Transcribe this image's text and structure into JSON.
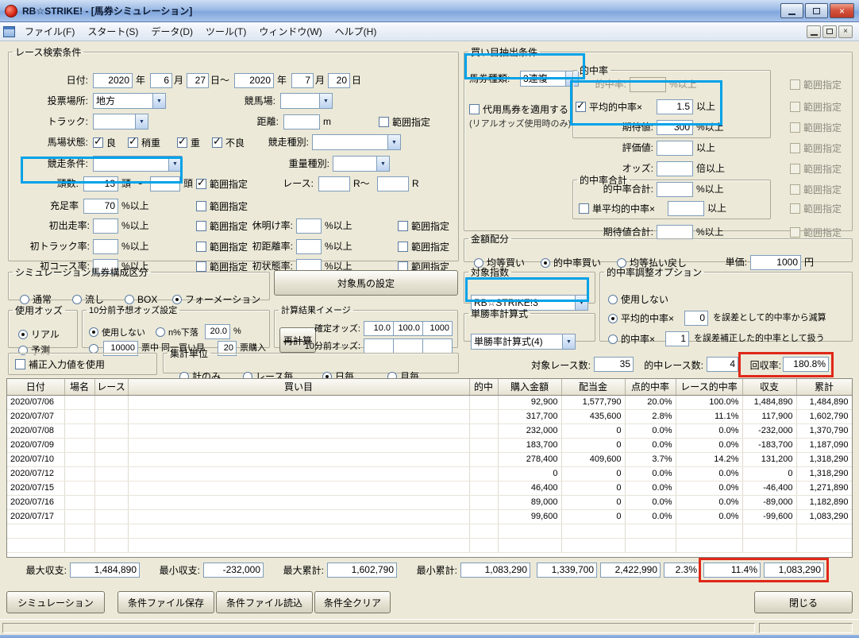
{
  "accent": {
    "annotation_blue": "#00a2e8",
    "annotation_red": "#e02818"
  },
  "win": {
    "title": "RB☆STRIKE! - [馬券シミュレーション]",
    "menu": [
      "ファイル(F)",
      "スタート(S)",
      "データ(D)",
      "ツール(T)",
      "ウィンドウ(W)",
      "ヘルプ(H)"
    ]
  },
  "search": {
    "title": "レース検索条件",
    "date": {
      "label": "日付:",
      "y1": "2020",
      "u1": "年",
      "m1": "6",
      "u2": "月",
      "d1": "27",
      "u3": "日～",
      "y2": "2020",
      "u4": "年",
      "m2": "7",
      "u5": "月",
      "d2": "20",
      "u6": "日"
    },
    "place": {
      "label": "投票場所:",
      "value": "地方"
    },
    "course": {
      "label": "競馬場:",
      "value": ""
    },
    "track": {
      "label": "トラック:",
      "value": ""
    },
    "dist": {
      "label": "距離:",
      "value": "",
      "unit": "m"
    },
    "range": "範囲指定",
    "baba": {
      "label": "馬場状態:",
      "o1": "良",
      "o2": "稍重",
      "o3": "重",
      "o4": "不良"
    },
    "shubetsu": {
      "label": "競走種別:",
      "value": ""
    },
    "joken": {
      "label": "競走条件:",
      "value": ""
    },
    "juryo": {
      "label": "重量種別:",
      "value": ""
    },
    "tosu": {
      "label": "頭数:",
      "v1": "13",
      "u1": "頭 ～",
      "v2": "",
      "u2": "頭"
    },
    "race_no": {
      "label": "レース:",
      "v1": "",
      "u1": "R～",
      "v2": "",
      "u2": "R"
    },
    "jusoku": {
      "label": "充足率",
      "value": "70",
      "unit": "%以上"
    },
    "r1": {
      "label": "初出走率:",
      "value": "",
      "unit": "%以上"
    },
    "r2": {
      "label": "休明け率:",
      "value": "",
      "unit": "%以上"
    },
    "r3": {
      "label": "初トラック率:",
      "value": "",
      "unit": "%以上"
    },
    "r4": {
      "label": "初距離率:",
      "value": "",
      "unit": "%以上"
    },
    "r5": {
      "label": "初コース率:",
      "value": "",
      "unit": "%以上"
    },
    "r6": {
      "label": "初状態率:",
      "value": "",
      "unit": "%以上"
    }
  },
  "extract": {
    "title": "買い目抽出条件",
    "type": {
      "label": "馬券種類:",
      "value": "3連複"
    },
    "daiyo": {
      "label": "代用馬券を適用する",
      "note": "(リアルオッズ使用時のみ)"
    },
    "hit_group": "的中率",
    "hit": {
      "label": "的中率:",
      "value": "",
      "unit": "%以上"
    },
    "avg": {
      "label": "平均的中率×",
      "value": "1.5",
      "unit": "以上"
    },
    "kitai": {
      "label": "期待値:",
      "value": "300",
      "unit": "%以上"
    },
    "hyoka": {
      "label": "評価値:",
      "value": "",
      "unit": "以上"
    },
    "odds": {
      "label": "オッズ:",
      "value": "",
      "unit": "倍以上"
    },
    "sum_group": "的中率合計",
    "hitsum": {
      "label": "的中率合計:",
      "value": "",
      "unit": "%以上"
    },
    "tanavg": {
      "label": "単平均的中率×",
      "value": "",
      "unit": "以上"
    },
    "kitaisum": {
      "label": "期待値合計:",
      "value": "",
      "unit": "%以上"
    },
    "range": "範囲指定"
  },
  "money": {
    "title": "金額配分",
    "o1": "均等買い",
    "o2": "的中率買い",
    "o3": "均等払い戻し",
    "unit_label": "単価:",
    "unit_value": "1000",
    "unit_suffix": "円"
  },
  "index": {
    "title": "対象指数",
    "value": "RB☆STRIKE!3"
  },
  "tansho": {
    "title": "単勝率計算式",
    "value": "単勝率計算式(4)"
  },
  "adjust": {
    "title": "的中率調整オプション",
    "o1": "使用しない",
    "o2a": "平均的中率×",
    "o2v": "0",
    "o2b": "を誤差として的中率から減算",
    "o3a": "的中率×",
    "o3v": "1",
    "o3b": "を誤差補正した的中率として扱う"
  },
  "kubun": {
    "title": "シミュレーション馬券構成区分",
    "o1": "通常",
    "o2": "流し",
    "o3": "BOX",
    "o4": "フォーメーション"
  },
  "target_btn": "対象馬の設定",
  "oddsrc": {
    "title": "使用オッズ",
    "o1": "リアル",
    "o2": "予測"
  },
  "pre10": {
    "title": "10分前予想オッズ設定",
    "o1": "使用しない",
    "o2a": "n%下落",
    "o2v": "20.0",
    "o2b": "%",
    "o3v1": "10000",
    "o3a": "票中 同一買い目",
    "o3v2": "20",
    "o3b": "票購入"
  },
  "calc": {
    "title": "計算結果イメージ",
    "recalc": "再計算",
    "row1_label": "確定オッズ:",
    "r1v1": "10.0",
    "r1v2": "100.0",
    "r1v3": "1000",
    "row2_label": "10分前オッズ:",
    "r2v1": "",
    "r2v2": "",
    "r2v3": ""
  },
  "hosei_label": "補正入力値を使用",
  "agg": {
    "title": "集計単位",
    "o1": "計のみ",
    "o2": "レース毎",
    "o3": "日毎",
    "o4": "月毎"
  },
  "stats": {
    "races_label": "対象レース数:",
    "races": "35",
    "hits_label": "的中レース数:",
    "hits": "4",
    "payout_label": "回収率:",
    "payout": "180.8%"
  },
  "table": {
    "headers": [
      "日付",
      "場名",
      "レース",
      "買い目",
      "的中",
      "購入金額",
      "配当金",
      "点的中率",
      "レース的中率",
      "収支",
      "累計"
    ],
    "rows": [
      {
        "date": "2020/07/06",
        "place": "",
        "race": "",
        "buy": "",
        "hit": "",
        "amount": "92,900",
        "payout": "1,577,790",
        "pt_rate": "20.0%",
        "race_rate": "100.0%",
        "balance": "1,484,890",
        "cum": "1,484,890"
      },
      {
        "date": "2020/07/07",
        "place": "",
        "race": "",
        "buy": "",
        "hit": "",
        "amount": "317,700",
        "payout": "435,600",
        "pt_rate": "2.8%",
        "race_rate": "11.1%",
        "balance": "117,900",
        "cum": "1,602,790"
      },
      {
        "date": "2020/07/08",
        "place": "",
        "race": "",
        "buy": "",
        "hit": "",
        "amount": "232,000",
        "payout": "0",
        "pt_rate": "0.0%",
        "race_rate": "0.0%",
        "balance": "-232,000",
        "cum": "1,370,790"
      },
      {
        "date": "2020/07/09",
        "place": "",
        "race": "",
        "buy": "",
        "hit": "",
        "amount": "183,700",
        "payout": "0",
        "pt_rate": "0.0%",
        "race_rate": "0.0%",
        "balance": "-183,700",
        "cum": "1,187,090"
      },
      {
        "date": "2020/07/10",
        "place": "",
        "race": "",
        "buy": "",
        "hit": "",
        "amount": "278,400",
        "payout": "409,600",
        "pt_rate": "3.7%",
        "race_rate": "14.2%",
        "balance": "131,200",
        "cum": "1,318,290"
      },
      {
        "date": "2020/07/12",
        "place": "",
        "race": "",
        "buy": "",
        "hit": "",
        "amount": "0",
        "payout": "0",
        "pt_rate": "0.0%",
        "race_rate": "0.0%",
        "balance": "0",
        "cum": "1,318,290"
      },
      {
        "date": "2020/07/15",
        "place": "",
        "race": "",
        "buy": "",
        "hit": "",
        "amount": "46,400",
        "payout": "0",
        "pt_rate": "0.0%",
        "race_rate": "0.0%",
        "balance": "-46,400",
        "cum": "1,271,890"
      },
      {
        "date": "2020/07/16",
        "place": "",
        "race": "",
        "buy": "",
        "hit": "",
        "amount": "89,000",
        "payout": "0",
        "pt_rate": "0.0%",
        "race_rate": "0.0%",
        "balance": "-89,000",
        "cum": "1,182,890"
      },
      {
        "date": "2020/07/17",
        "place": "",
        "race": "",
        "buy": "",
        "hit": "",
        "amount": "99,600",
        "payout": "0",
        "pt_rate": "0.0%",
        "race_rate": "0.0%",
        "balance": "-99,600",
        "cum": "1,083,290"
      }
    ]
  },
  "summary": {
    "max_bal_label": "最大収支:",
    "max_bal": "1,484,890",
    "min_bal_label": "最小収支:",
    "min_bal": "-232,000",
    "max_cum_label": "最大累計:",
    "max_cum": "1,602,790",
    "min_cum_label": "最小累計:",
    "min_cum": "1,083,290",
    "total_amount": "1,339,700",
    "total_payout": "2,422,990",
    "total_pt_rate": "2.3%",
    "total_race_rate": "11.4%",
    "total_balance": "1,083,290"
  },
  "buttons": {
    "simulate": "シミュレーション",
    "save": "条件ファイル保存",
    "load": "条件ファイル読込",
    "clear": "条件全クリア",
    "close": "閉じる"
  },
  "state": {
    "baba_ryo": true,
    "baba_yayaomo": true,
    "baba_omo": true,
    "baba_furyo": true,
    "dist_range": false,
    "tosu_range": true,
    "jusoku_range": false,
    "r1_range": false,
    "r2_range": false,
    "r3_range": false,
    "r4_range": false,
    "r5_range": false,
    "r6_range": false,
    "daiyo": false,
    "avg_check": true,
    "tanavg_check": false,
    "ex_range": [
      false,
      false,
      false,
      false,
      false,
      false,
      false,
      false
    ],
    "money": [
      false,
      true,
      false
    ],
    "kubun": [
      false,
      false,
      false,
      true
    ],
    "odds_src": [
      true,
      false
    ],
    "pre10": [
      true,
      false,
      false
    ],
    "adjust": [
      false,
      true,
      false
    ],
    "hosei": false,
    "agg": [
      false,
      false,
      true,
      false
    ]
  }
}
